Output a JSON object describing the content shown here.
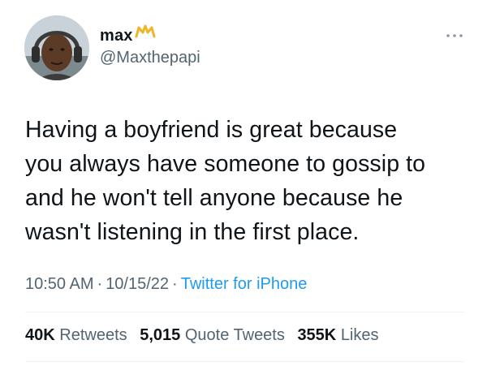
{
  "user": {
    "display_name": "max",
    "handle": "@Maxthepapi",
    "crown_color": "#f0b429"
  },
  "tweet": {
    "lines": [
      "Having a boyfriend is great because",
      "you always have someone to gossip to",
      "and he won't tell anyone because he",
      "wasn't listening in the first place."
    ]
  },
  "meta": {
    "time": "10:50 AM",
    "date": "10/15/22",
    "source": "Twitter for iPhone",
    "separator": "·"
  },
  "stats": {
    "retweets_count": "40K",
    "retweets_label": "Retweets",
    "quotes_count": "5,015",
    "quotes_label": "Quote Tweets",
    "likes_count": "355K",
    "likes_label": "Likes"
  },
  "icons": {
    "more": "more-options-icon",
    "crown": "crown-emoji-icon"
  },
  "colors": {
    "text_primary": "#0f1419",
    "text_secondary": "#536471",
    "link": "#1d9bf0",
    "divider": "#eff3f4"
  }
}
